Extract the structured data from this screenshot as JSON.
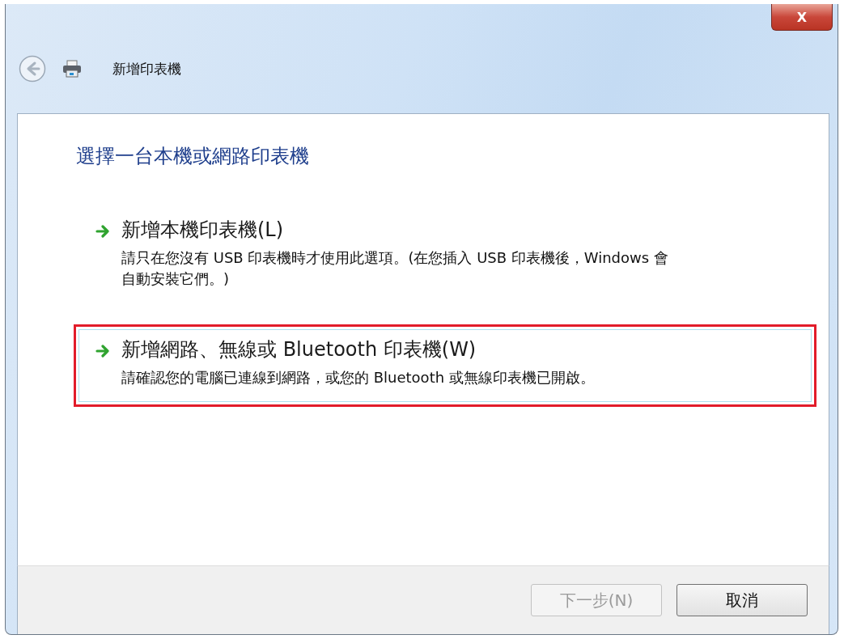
{
  "window": {
    "title": "新增印表機",
    "close_label": "X"
  },
  "heading": "選擇一台本機或網路印表機",
  "options": [
    {
      "title": "新增本機印表機(L)",
      "description": "請只在您沒有 USB 印表機時才使用此選項。(在您插入 USB 印表機後，Windows 會自動安裝它們。)",
      "selected": false,
      "highlighted": false
    },
    {
      "title": "新增網路、無線或 Bluetooth 印表機(W)",
      "description": "請確認您的電腦已連線到網路，或您的 Bluetooth 或無線印表機已開啟。",
      "selected": true,
      "highlighted": true
    }
  ],
  "buttons": [
    {
      "label": "下一步(N)",
      "disabled": true
    },
    {
      "label": "取消",
      "disabled": false
    }
  ]
}
